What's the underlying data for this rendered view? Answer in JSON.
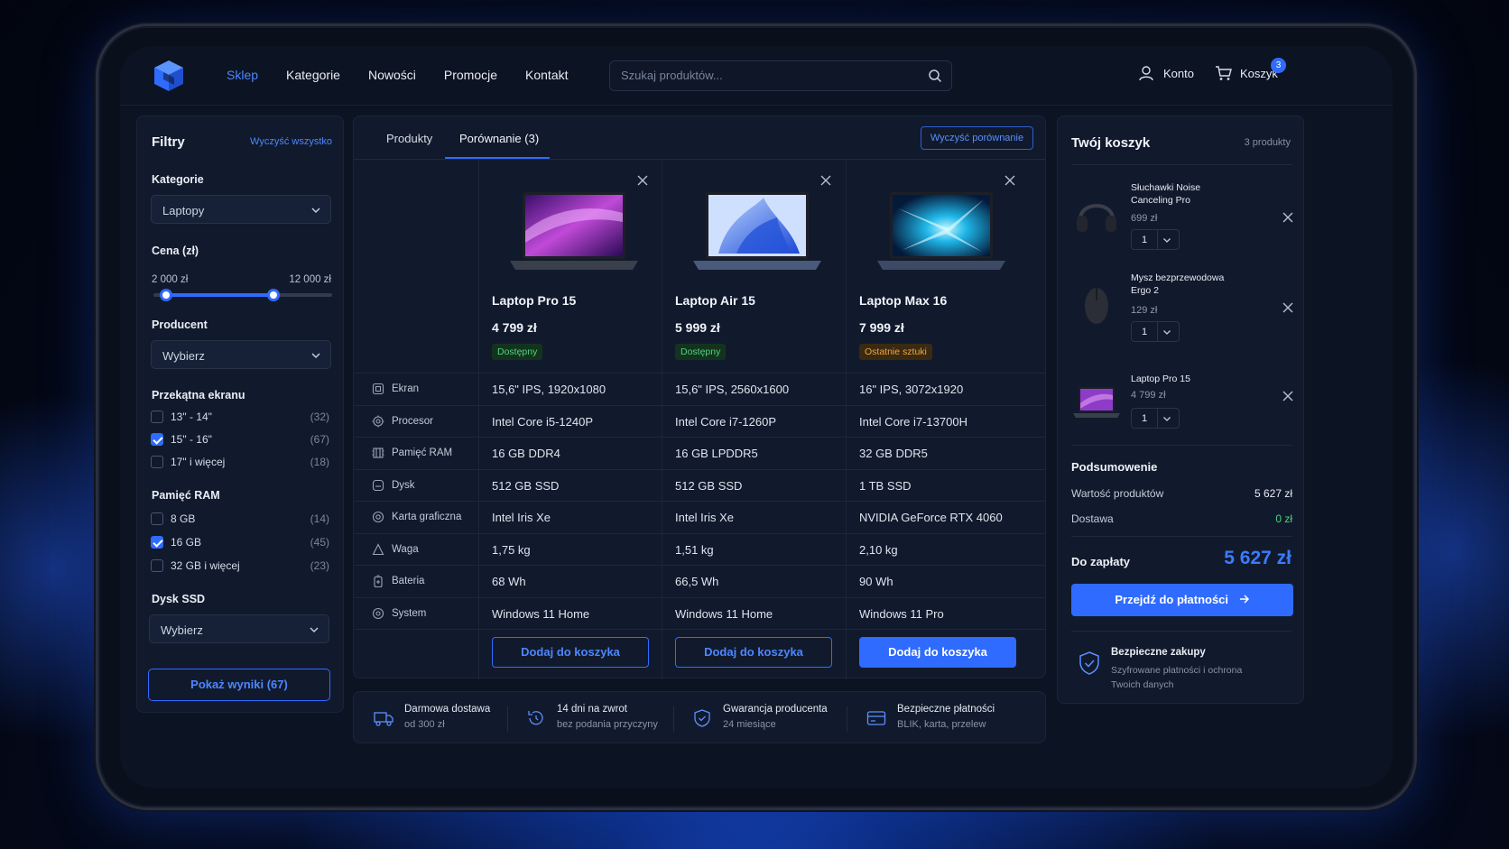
{
  "header": {
    "nav": [
      "Sklep",
      "Kategorie",
      "Nowości",
      "Promocje",
      "Kontakt"
    ],
    "search_placeholder": "Szukaj produktów...",
    "account_label": "Konto",
    "cart_label": "Koszyk",
    "cart_badge": "3"
  },
  "filters": {
    "title": "Filtry",
    "clear_all": "Wyczyść wszystko",
    "category_label": "Kategorie",
    "category_value": "Laptopy",
    "price_label": "Cena (zł)",
    "price_min": "2 000 zł",
    "price_max": "12 000 zł",
    "price_range_fraction": [
      0.07,
      0.67
    ],
    "producer_label": "Producent",
    "producer_value": "Wybierz",
    "screen_label": "Przekątna ekranu",
    "screen_options": [
      {
        "label": "13\" - 14\"",
        "count": "(32)",
        "checked": false
      },
      {
        "label": "15\" - 16\"",
        "count": "(67)",
        "checked": true
      },
      {
        "label": "17\" i więcej",
        "count": "(18)",
        "checked": false
      }
    ],
    "ram_label": "Pamięć RAM",
    "ram_options": [
      {
        "label": "8 GB",
        "count": "(14)",
        "checked": false
      },
      {
        "label": "16 GB",
        "count": "(45)",
        "checked": true
      },
      {
        "label": "32 GB i więcej",
        "count": "(23)",
        "checked": false
      }
    ],
    "ssd_label": "Dysk SSD",
    "ssd_value": "Wybierz",
    "show_results": "Pokaż wyniki (67)"
  },
  "compare": {
    "tab_products": "Produkty",
    "tab_compare": "Porównanie (3)",
    "clear_compare": "Wyczyść porównanie",
    "products": [
      {
        "name": "Laptop Pro 15",
        "price": "4 799 zł",
        "status": "Dostępny",
        "status_type": "ok",
        "add": "Dodaj do koszyka"
      },
      {
        "name": "Laptop Air 15",
        "price": "5 999 zł",
        "status": "Dostępny",
        "status_type": "ok",
        "add": "Dodaj do koszyka"
      },
      {
        "name": "Laptop Max 16",
        "price": "7 999 zł",
        "status": "Ostatnie sztuki",
        "status_type": "warn",
        "add": "Dodaj do koszyka"
      }
    ],
    "specs": [
      {
        "label": "Ekran",
        "icon": "screen-icon",
        "values": [
          "15,6\" IPS, 1920x1080",
          "15,6\" IPS, 2560x1600",
          "16\" IPS, 3072x1920"
        ]
      },
      {
        "label": "Procesor",
        "icon": "cpu-icon",
        "values": [
          "Intel Core i5-1240P",
          "Intel Core i7-1260P",
          "Intel Core i7-13700H"
        ]
      },
      {
        "label": "Pamięć RAM",
        "icon": "memory-icon",
        "values": [
          "16 GB DDR4",
          "16 GB LPDDR5",
          "32 GB DDR5"
        ]
      },
      {
        "label": "Dysk",
        "icon": "disk-icon",
        "values": [
          "512 GB SSD",
          "512 GB SSD",
          "1 TB SSD"
        ]
      },
      {
        "label": "Karta graficzna",
        "icon": "gpu-icon",
        "values": [
          "Intel Iris Xe",
          "Intel Iris Xe",
          "NVIDIA GeForce RTX 4060"
        ]
      },
      {
        "label": "Waga",
        "icon": "weight-icon",
        "values": [
          "1,75 kg",
          "1,51 kg",
          "2,10 kg"
        ]
      },
      {
        "label": "Bateria",
        "icon": "battery-icon",
        "values": [
          "68 Wh",
          "66,5 Wh",
          "90 Wh"
        ]
      },
      {
        "label": "System",
        "icon": "system-icon",
        "values": [
          "Windows 11 Home",
          "Windows 11 Home",
          "Windows 11 Pro"
        ]
      }
    ]
  },
  "perks": [
    {
      "title": "Darmowa dostawa",
      "sub": "od 300 zł",
      "icon": "truck-icon"
    },
    {
      "title": "14 dni na zwrot",
      "sub": "bez podania przyczyny",
      "icon": "return-icon"
    },
    {
      "title": "Gwarancja producenta",
      "sub": "24 miesiące",
      "icon": "shield-icon"
    },
    {
      "title": "Bezpieczne płatności",
      "sub": "BLIK, karta, przelew",
      "icon": "card-icon"
    }
  ],
  "cart": {
    "title": "Twój koszyk",
    "count": "3 produkty",
    "items": [
      {
        "name": "Słuchawki Noise Canceling Pro",
        "price": "699 zł",
        "qty": "1"
      },
      {
        "name": "Mysz bezprzewodowa Ergo 2",
        "price": "129 zł",
        "qty": "1"
      },
      {
        "name": "Laptop Pro 15",
        "price": "4 799 zł",
        "qty": "1"
      }
    ],
    "summary_title": "Podsumowenie",
    "products_value_label": "Wartość produktów",
    "products_value": "5 627 zł",
    "shipping_label": "Dostawa",
    "shipping_value": "0 zł",
    "total_label": "Do zapłaty",
    "total_value": "5 627 zł",
    "checkout": "Przejdź do płatności",
    "secure_title": "Bezpieczne zakupy",
    "secure_sub": "Szyfrowane płatności i ochrona Twoich danych"
  },
  "colors": {
    "accent": "#2f6bff",
    "success": "#4fd37a",
    "warning": "#f2a53a",
    "bg": "#0c1322"
  }
}
